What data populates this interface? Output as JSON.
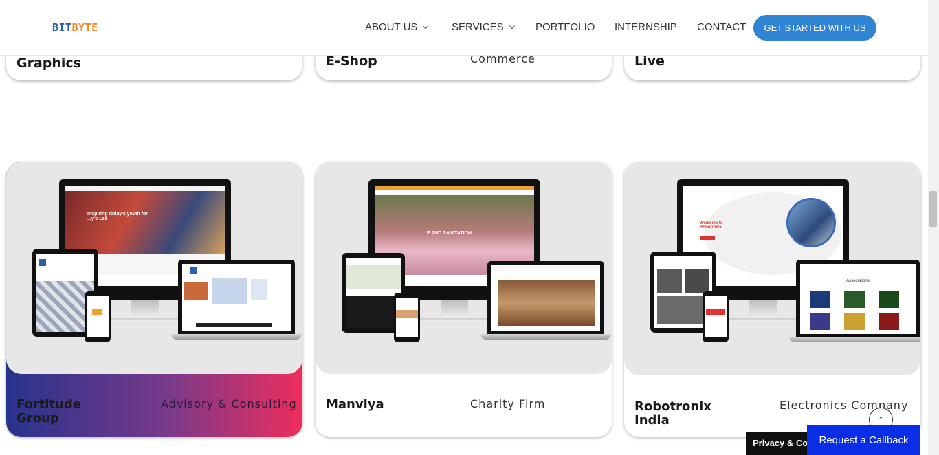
{
  "header": {
    "logo_part1": "BIT",
    "logo_part2": "BYTE",
    "nav": {
      "about": "ABOUT US",
      "services": "SERVICES",
      "portfolio": "PORTFOLIO",
      "internship": "INTERNSHIP",
      "contact": "CONTACT"
    },
    "cta_label": "GET STARTED WITH US"
  },
  "top_cards": [
    {
      "title": "Graphics",
      "subtitle": ""
    },
    {
      "title": "E-Shop",
      "subtitle": "Commerce"
    },
    {
      "title": "Live",
      "subtitle": ""
    }
  ],
  "cards": [
    {
      "title": "Fortitude Group",
      "subtitle": "Advisory & Consulting"
    },
    {
      "title": "Manviya",
      "subtitle": "Charity Firm"
    },
    {
      "title": "Robotronix India",
      "subtitle": "Electronics Company"
    }
  ],
  "mockups": {
    "fortitude_hero": "Inspiring today's youth for ...y's Lea",
    "manviya_hero": "...E AND SANITATION",
    "robotronix_hero": "Welcome to Robotronix",
    "robotronix_laptop_heading": "Associations"
  },
  "floating": {
    "privacy_label": "Privacy & Coo",
    "callback_label": "Request a Callback",
    "totop_icon": "↑"
  },
  "colors": {
    "accent": "#2f84d3",
    "callback": "#0a2ee5",
    "gradient_start": "#27338c",
    "gradient_end": "#ef2d5c"
  }
}
